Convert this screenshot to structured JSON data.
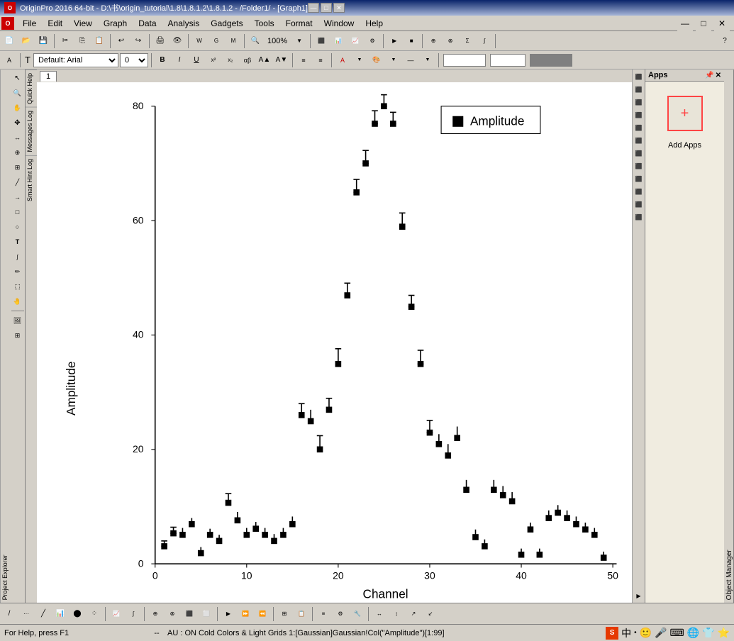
{
  "titlebar": {
    "title": "OriginPro 2016 64-bit - D:\\书\\origin_tutorial\\1.8\\1.8.1.2\\1.8.1.2 - /Folder1/ - [Graph1]",
    "minimize": "—",
    "maximize": "□",
    "close": "✕"
  },
  "menubar": {
    "items": [
      "File",
      "Edit",
      "View",
      "Graph",
      "Data",
      "Analysis",
      "Gadgets",
      "Tools",
      "Format",
      "Window",
      "Help"
    ]
  },
  "apps_panel": {
    "title": "Apps",
    "add_apps_label": "Add Apps",
    "add_icon": "+"
  },
  "graph": {
    "tab": "1",
    "x_label": "Channel",
    "y_label": "Amplitude",
    "legend_label": "Amplitude",
    "x_min": 0,
    "x_max": 50,
    "y_min": 0,
    "y_max": 80
  },
  "statusbar": {
    "help_text": "For Help, press F1",
    "separator": "--",
    "status_text": "AU : ON  Cold Colors & Light Grids  1:[Gaussian]Gaussian!Col(\"Amplitude\")[1:99]"
  },
  "left_panels": {
    "project_explorer": "Project Explorer",
    "quick_help": "Quick Help",
    "messages_log": "Messages Log",
    "smart_hint_log": "Smart Hint Log"
  },
  "font_toolbar": {
    "font_name": "Default: Arial",
    "font_size": "0",
    "bold": "B",
    "italic": "I",
    "underline": "U"
  }
}
